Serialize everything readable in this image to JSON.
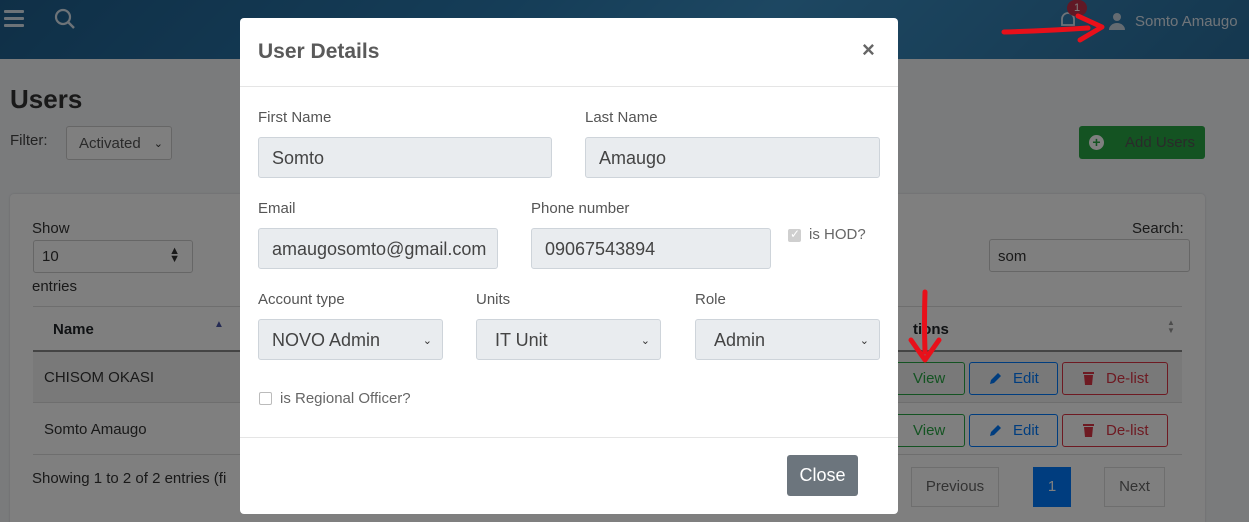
{
  "topbar": {
    "notification_count": "1",
    "user_name": "Somto Amaugo"
  },
  "page": {
    "title": "Users",
    "filter_label": "Filter:",
    "filter_value": "Activated",
    "add_users_label": "Add Users"
  },
  "table": {
    "show_label": "Show",
    "length_value": "10",
    "entries_label": "entries",
    "search_label": "Search:",
    "search_value": "som",
    "headers": {
      "name": "Name",
      "actions": "tions"
    },
    "rows": [
      {
        "name": "CHISOM OKASI",
        "view": "View",
        "edit": "Edit",
        "delist": "De-list"
      },
      {
        "name": "Somto Amaugo",
        "view": "View",
        "edit": "Edit",
        "delist": "De-list"
      }
    ],
    "info": "Showing 1 to 2 of 2 entries (fi",
    "pagination": {
      "previous": "Previous",
      "current": "1",
      "next": "Next"
    }
  },
  "modal": {
    "title": "User Details",
    "close_symbol": "×",
    "first_name_label": "First Name",
    "first_name_value": "Somto",
    "last_name_label": "Last Name",
    "last_name_value": "Amaugo",
    "email_label": "Email",
    "email_value": "amaugosomto@gmail.com",
    "phone_label": "Phone number",
    "phone_value": "09067543894",
    "is_hod_label": "is HOD?",
    "is_hod_checked": true,
    "account_type_label": "Account type",
    "account_type_value": "NOVO Admin",
    "units_label": "Units",
    "units_value": "IT Unit",
    "role_label": "Role",
    "role_value": "Admin",
    "regional_officer_label": "is Regional Officer?",
    "regional_officer_checked": false,
    "close_label": "Close"
  },
  "colors": {
    "topbar": "#2b7bb0",
    "add_button": "#28a745",
    "view": "#28a745",
    "edit": "#007bff",
    "delist": "#dc3545",
    "badge": "#c0304a",
    "annotation_arrow": "#e8101a"
  },
  "icons": [
    "hamburger-menu-icon",
    "search-icon",
    "bell-icon",
    "user-icon",
    "plus-circle-icon",
    "eye-icon",
    "pencil-icon",
    "trash-icon",
    "chevron-down-icon",
    "sort-icon"
  ]
}
